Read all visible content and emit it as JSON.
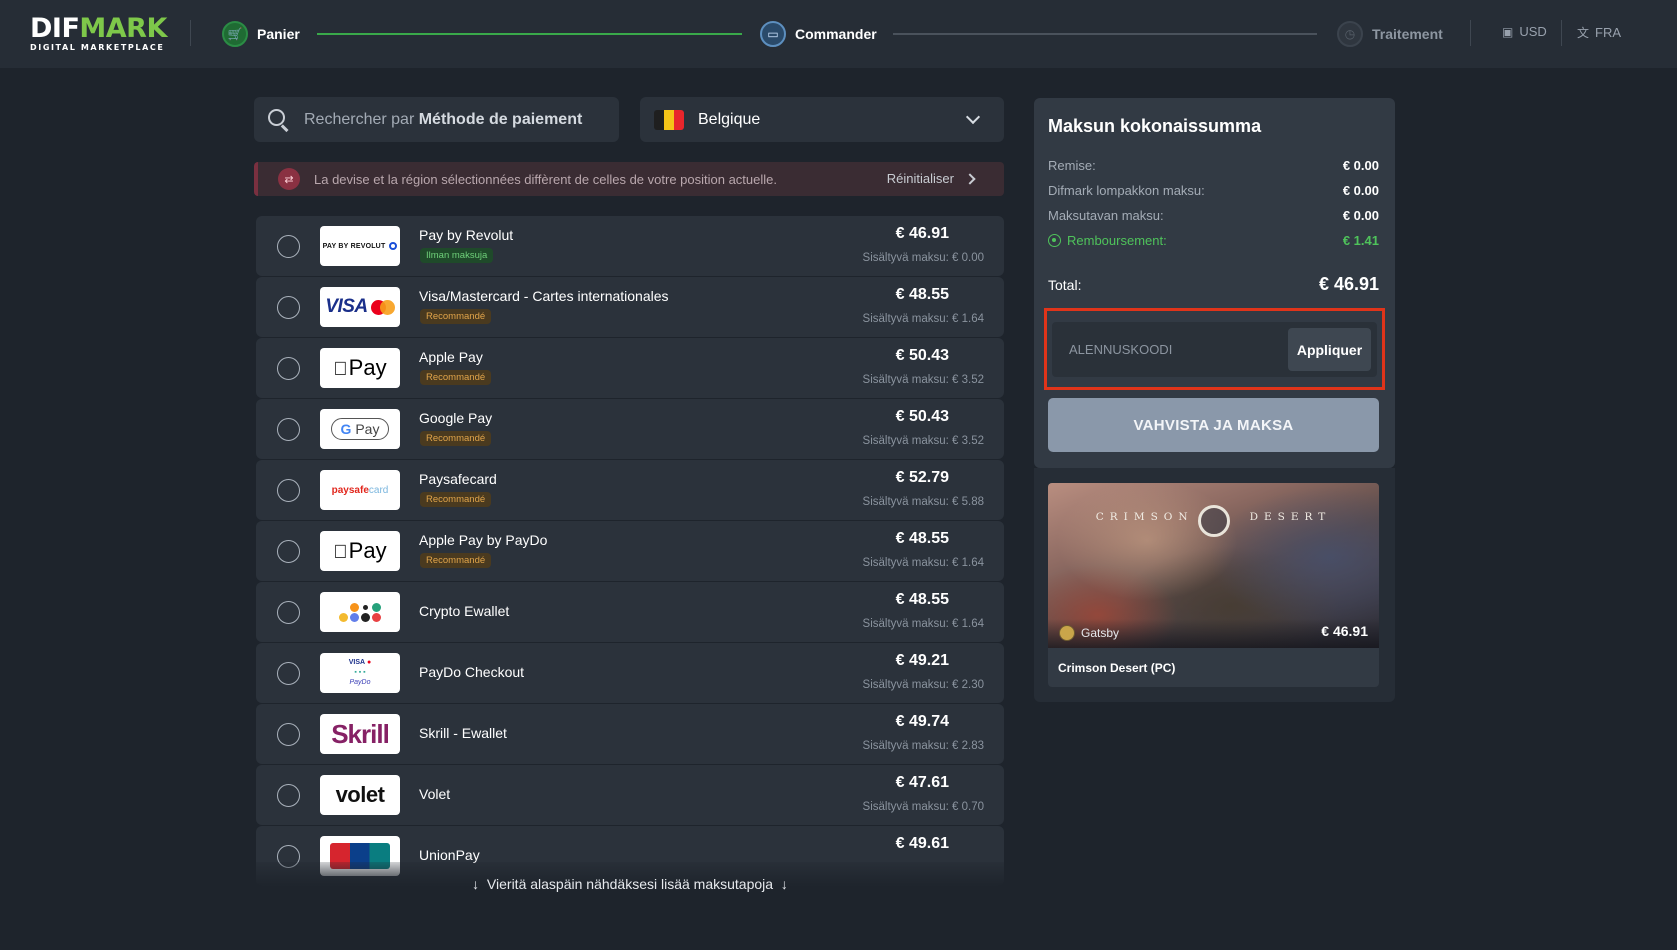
{
  "logo": {
    "main_white": "DIF",
    "main_green": "MARK",
    "tagline": "DIGITAL MARKETPLACE"
  },
  "steps": [
    {
      "label": "Panier",
      "state": "done"
    },
    {
      "label": "Commander",
      "state": "active"
    },
    {
      "label": "Traitement",
      "state": "todo"
    }
  ],
  "header": {
    "currency": "USD",
    "language": "FRA"
  },
  "search": {
    "prefix": "Rechercher par ",
    "bold": "Méthode de paiement"
  },
  "country": {
    "label": "Belgique",
    "flag_colors": [
      "#1f1f1f",
      "#f5c418",
      "#e8262c"
    ]
  },
  "alert": {
    "text": "La devise et la région sélectionnées diffèrent de celles de votre position actuelle.",
    "reset": "Réinitialiser"
  },
  "payments": [
    {
      "name": "Pay by Revolut",
      "badge": "Ilman maksuja",
      "badge_type": "free",
      "price": "€ 46.91",
      "fee": "Sisältyvä maksu: € 0.00",
      "logo": "revolut"
    },
    {
      "name": "Visa/Mastercard - Cartes internationales",
      "badge": "Recommandé",
      "badge_type": "rec",
      "price": "€ 48.55",
      "fee": "Sisältyvä maksu: € 1.64",
      "logo": "visa"
    },
    {
      "name": "Apple Pay",
      "badge": "Recommandé",
      "badge_type": "rec",
      "price": "€ 50.43",
      "fee": "Sisältyvä maksu: € 3.52",
      "logo": "apple"
    },
    {
      "name": "Google Pay",
      "badge": "Recommandé",
      "badge_type": "rec",
      "price": "€ 50.43",
      "fee": "Sisältyvä maksu: € 3.52",
      "logo": "gpay"
    },
    {
      "name": "Paysafecard",
      "badge": "Recommandé",
      "badge_type": "rec",
      "price": "€ 52.79",
      "fee": "Sisältyvä maksu: € 5.88",
      "logo": "paysafecard"
    },
    {
      "name": "Apple Pay by PayDo",
      "badge": "Recommandé",
      "badge_type": "rec",
      "price": "€ 48.55",
      "fee": "Sisältyvä maksu: € 1.64",
      "logo": "apple"
    },
    {
      "name": "Crypto Ewallet",
      "badge": "",
      "badge_type": "",
      "price": "€ 48.55",
      "fee": "Sisältyvä maksu: € 1.64",
      "logo": "crypto"
    },
    {
      "name": "PayDo Checkout",
      "badge": "",
      "badge_type": "",
      "price": "€ 49.21",
      "fee": "Sisältyvä maksu: € 2.30",
      "logo": "paydo"
    },
    {
      "name": "Skrill - Ewallet",
      "badge": "",
      "badge_type": "",
      "price": "€ 49.74",
      "fee": "Sisältyvä maksu: € 2.83",
      "logo": "skrill"
    },
    {
      "name": "Volet",
      "badge": "",
      "badge_type": "",
      "price": "€ 47.61",
      "fee": "Sisältyvä maksu: € 0.70",
      "logo": "volet"
    },
    {
      "name": "UnionPay",
      "badge": "",
      "badge_type": "",
      "price": "€ 49.61",
      "fee": "",
      "logo": "unionpay"
    }
  ],
  "logo_text": {
    "revolut": "PAY BY REVOLUT",
    "visa": "VISA",
    "apple": "Pay",
    "gpay_g": "G",
    "gpay": " Pay",
    "psc_main": "paysafe",
    "psc_card": "card",
    "paydo_line1": "VISA",
    "paydo_line2": "PayDo",
    "skrill": "Skrill",
    "volet": "volet"
  },
  "scroll_hint": "Vieritä alaspäin nähdäksesi lisää maksutapoja",
  "summary": {
    "title": "Maksun kokonaissumma",
    "rows": [
      {
        "label": "Remise:",
        "value": "€ 0.00"
      },
      {
        "label": "Difmark lompakkon maksu:",
        "value": "€ 0.00"
      },
      {
        "label": "Maksutavan maksu:",
        "value": "€ 0.00"
      },
      {
        "label": "Remboursement:",
        "value": "€ 1.41"
      }
    ],
    "total_label": "Total:",
    "total_value": "€ 46.91",
    "promo_placeholder": "ALENNUSKOODI",
    "apply_label": "Appliquer",
    "confirm_label": "VAHVISTA JA MAKSA"
  },
  "product": {
    "art_left": "CRIMSON",
    "art_right": "DESERT",
    "seller": "Gatsby",
    "price": "€ 46.91",
    "name": "Crimson Desert (PC)"
  },
  "colors": {
    "accent_green": "#4fc35b",
    "highlight_red": "#e0341a",
    "button_disabled": "#8a98aa"
  }
}
